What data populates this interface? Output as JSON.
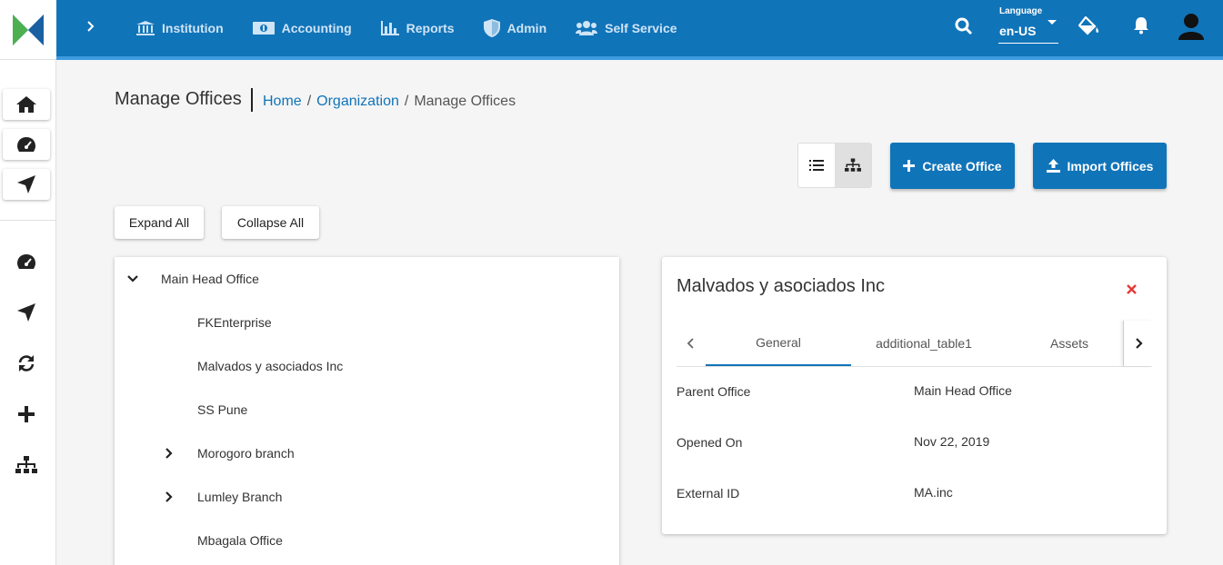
{
  "header": {
    "nav": [
      {
        "label": "Institution",
        "icon": "bank-icon"
      },
      {
        "label": "Accounting",
        "icon": "money-icon"
      },
      {
        "label": "Reports",
        "icon": "bar-chart-icon"
      },
      {
        "label": "Admin",
        "icon": "shield-icon"
      },
      {
        "label": "Self Service",
        "icon": "users-icon"
      }
    ],
    "language_label": "Language",
    "language_value": "en-US"
  },
  "page": {
    "title": "Manage Offices",
    "breadcrumb": [
      "Home",
      "/",
      "Organization",
      "/",
      "Manage Offices"
    ]
  },
  "actions": {
    "create_office": "Create Office",
    "import_offices": "Import Offices",
    "expand_all": "Expand All",
    "collapse_all": "Collapse All"
  },
  "tree": {
    "root": "Main Head Office",
    "children": [
      {
        "label": "FKEnterprise",
        "expandable": false
      },
      {
        "label": "Malvados y asociados Inc",
        "expandable": false
      },
      {
        "label": "SS Pune",
        "expandable": false
      },
      {
        "label": "Morogoro branch",
        "expandable": true
      },
      {
        "label": "Lumley Branch",
        "expandable": true
      },
      {
        "label": "Mbagala Office",
        "expandable": false
      }
    ]
  },
  "detail": {
    "title": "Malvados y asociados Inc",
    "tabs": [
      "General",
      "additional_table1",
      "Assets"
    ],
    "active_tab": "General",
    "fields": [
      {
        "label": "Parent Office",
        "value": "Main Head Office"
      },
      {
        "label": "Opened On",
        "value": "Nov 22, 2019"
      },
      {
        "label": "External ID",
        "value": "MA.inc"
      }
    ]
  },
  "colors": {
    "primary": "#1074b9",
    "close": "#e53935"
  }
}
